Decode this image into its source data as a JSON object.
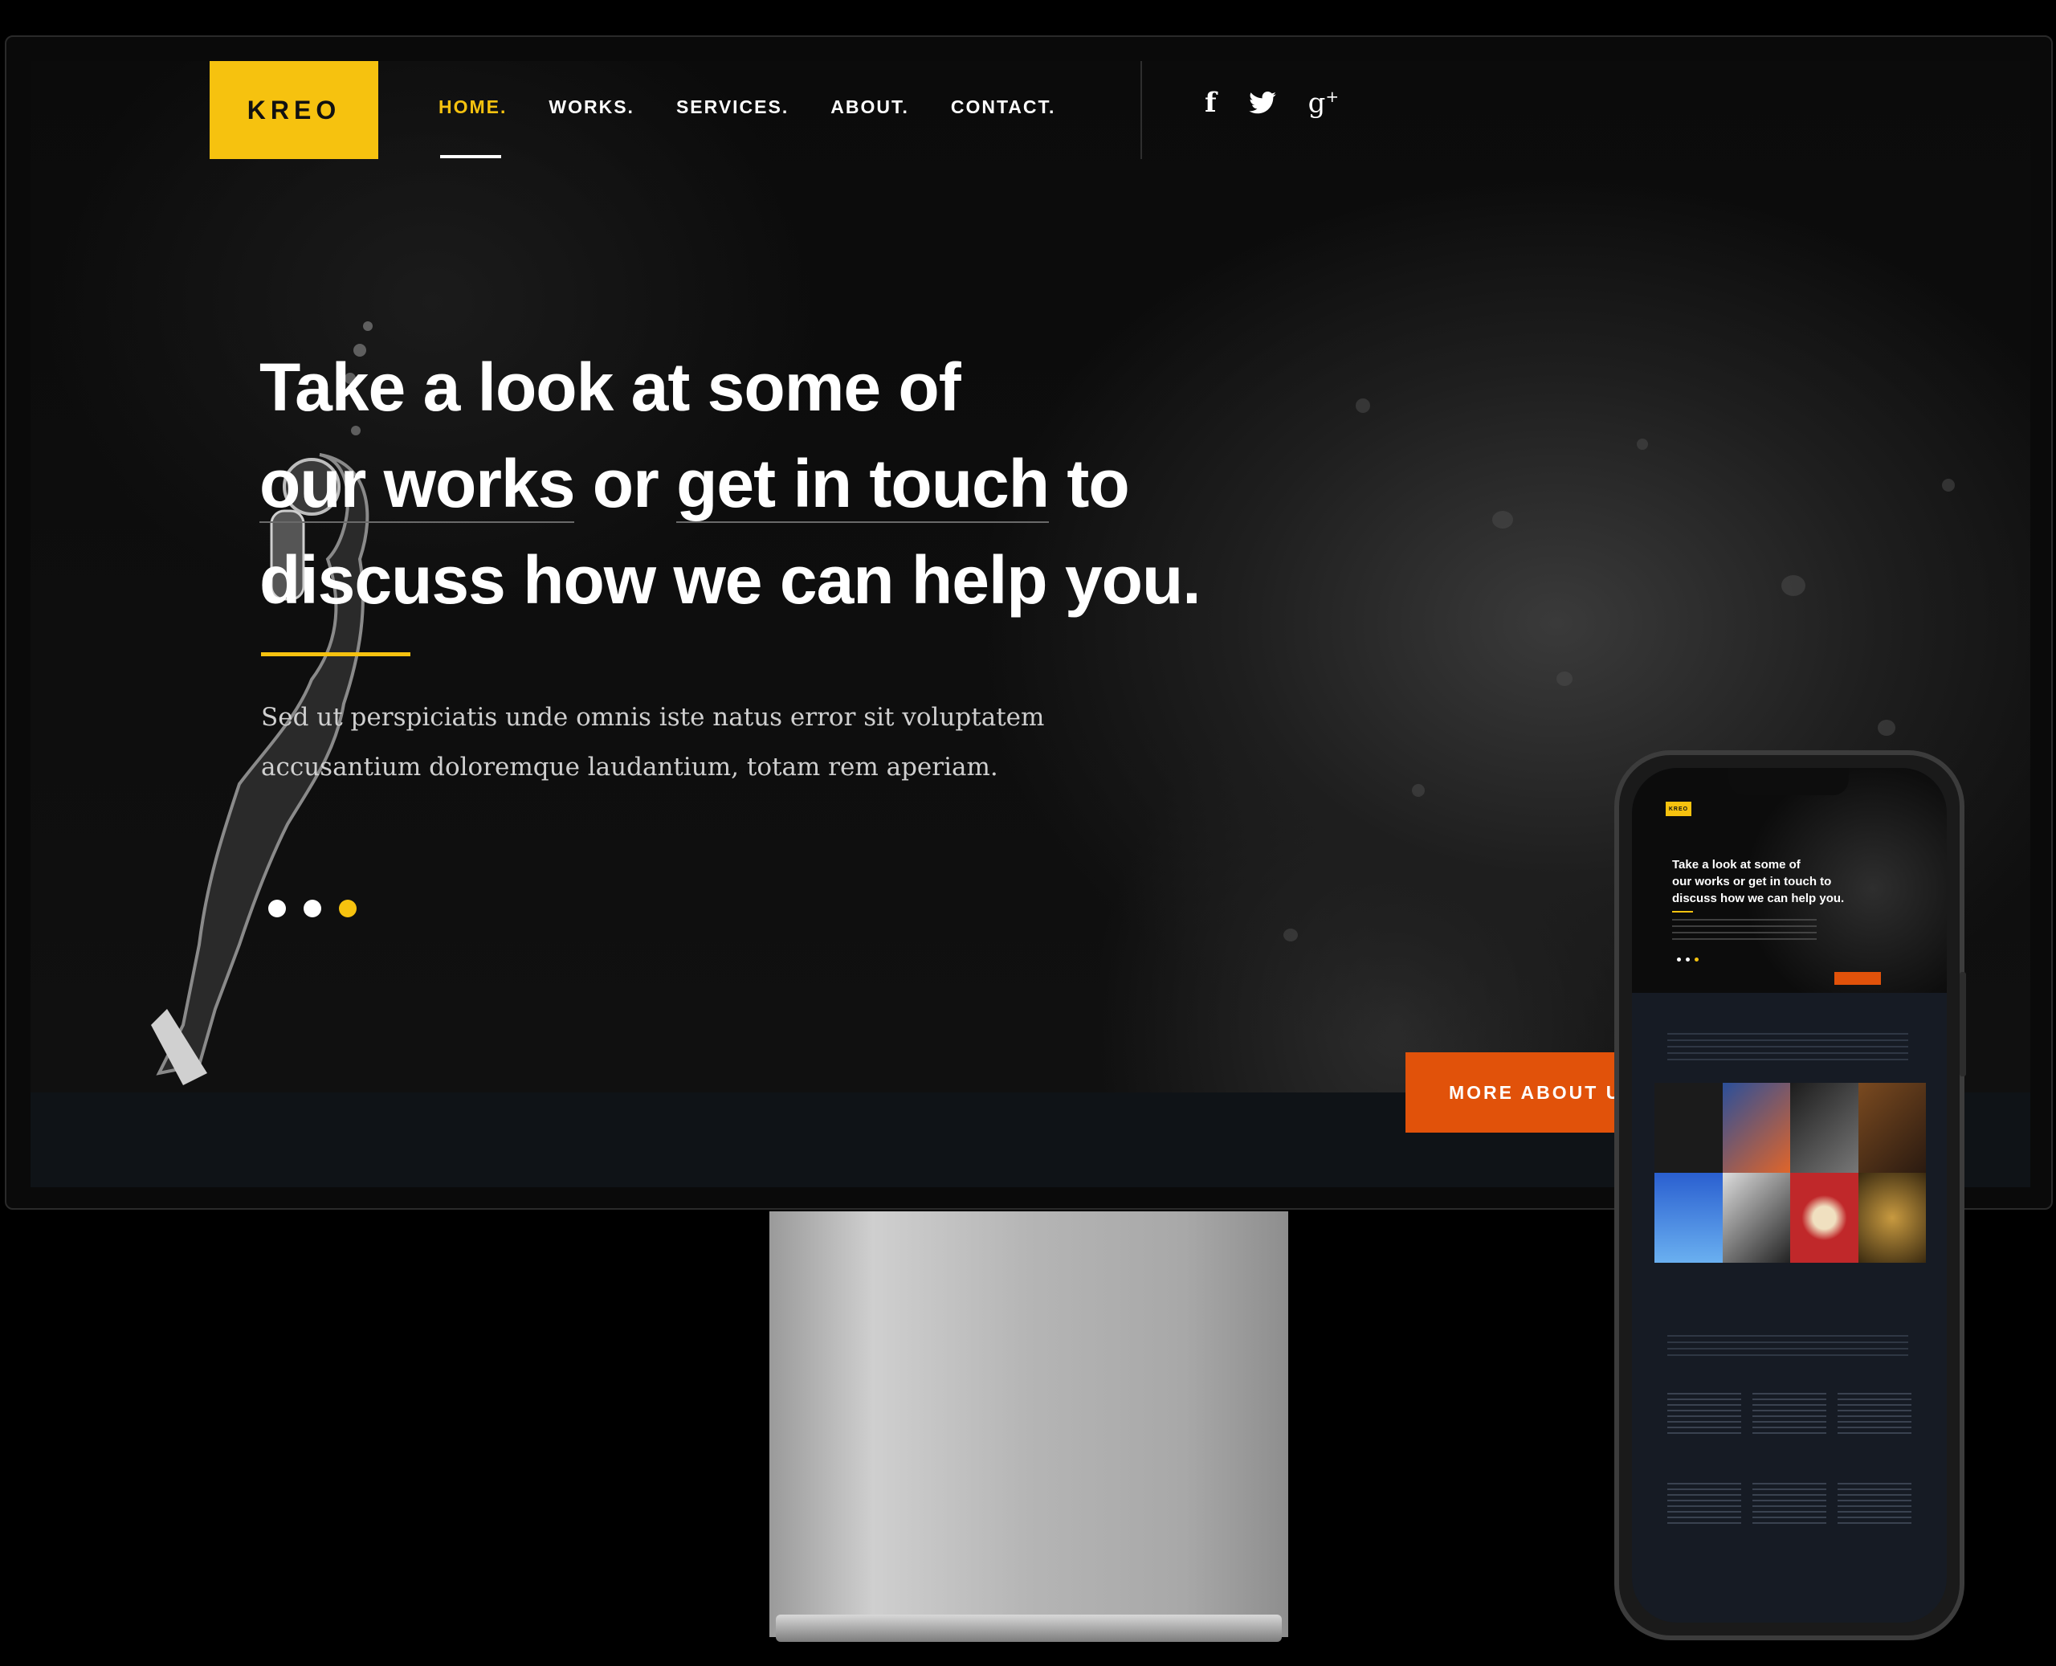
{
  "desktop": {
    "logo": "KREO",
    "nav": [
      {
        "label": "HOME.",
        "active": true
      },
      {
        "label": "WORKS.",
        "active": false
      },
      {
        "label": "SERVICES.",
        "active": false
      },
      {
        "label": "ABOUT.",
        "active": false
      },
      {
        "label": "CONTACT.",
        "active": false
      }
    ],
    "social": [
      {
        "icon": "facebook-icon",
        "glyph": "f"
      },
      {
        "icon": "twitter-icon",
        "glyph": "🐦"
      },
      {
        "icon": "google-plus-icon",
        "glyph": "g+"
      }
    ],
    "headline": {
      "line1": "Take a look at some of",
      "line2a": "our works",
      "line2b": " or ",
      "line2c": "get in touch",
      "line2d": " to",
      "line3": "discuss how we can help you."
    },
    "lead_line1": "Sed ut perspiciatis unde omnis iste natus error sit voluptatem",
    "lead_line2": "accusantium doloremque laudantium, totam rem aperiam.",
    "slider": {
      "count": 3,
      "active_index": 2
    },
    "cta": "MORE ABOUT US"
  },
  "phone": {
    "logo": "KREO",
    "headline_line1": "Take a look at some of",
    "headline_line2": "our works or get in touch to",
    "headline_line3": "discuss how we can help you.",
    "slider": {
      "count": 3,
      "active_index": 2
    }
  },
  "colors": {
    "accent": "#f6c20f",
    "cta": "#e1520a",
    "background": "#0b0b0b",
    "footer": "#0f1317"
  }
}
